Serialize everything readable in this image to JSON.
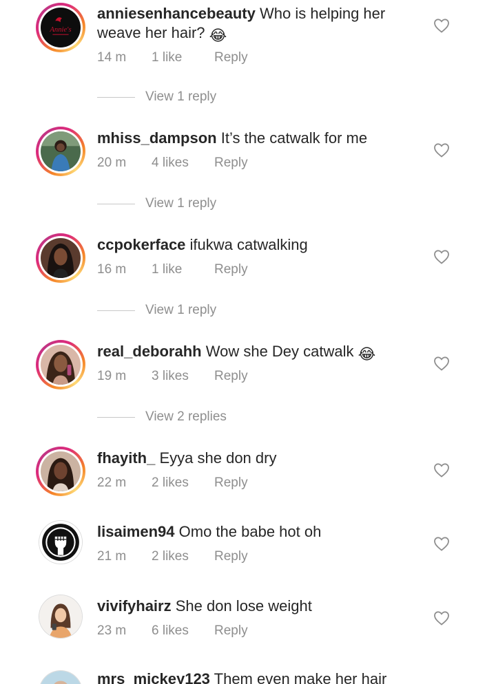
{
  "comments": [
    {
      "username": "anniesenhancebeauty",
      "text": "Who is helping her weave her hair?",
      "emoji": "😂",
      "time": "14 m",
      "likes": "1 like",
      "reply": "Reply",
      "view_replies": "View 1 reply",
      "avatar": "annies-logo"
    },
    {
      "username": "mhiss_dampson",
      "text": "It’s the catwalk for me",
      "time": "20 m",
      "likes": "4 likes",
      "reply": "Reply",
      "view_replies": "View 1 reply",
      "avatar": "woman-photo"
    },
    {
      "username": "ccpokerface",
      "text": "ifukwa catwalking",
      "time": "16 m",
      "likes": "1 like",
      "reply": "Reply",
      "view_replies": "View 1 reply",
      "avatar": "woman-photo"
    },
    {
      "username": "real_deborahh",
      "text": "Wow she Dey catwalk",
      "emoji": "😂",
      "time": "19 m",
      "likes": "3 likes",
      "reply": "Reply",
      "view_replies": "View 2 replies",
      "avatar": "woman-photo"
    },
    {
      "username": "fhayith_",
      "text": "Eyya she don dry",
      "time": "22 m",
      "likes": "2 likes",
      "reply": "Reply",
      "avatar": "woman-photo"
    },
    {
      "username": "lisaimen94",
      "text": "Omo the babe hot oh",
      "time": "21 m",
      "likes": "2 likes",
      "reply": "Reply",
      "avatar": "raised-fist-logo"
    },
    {
      "username": "vivifyhairz",
      "text": "She don lose weight",
      "time": "23 m",
      "likes": "6 likes",
      "reply": "Reply",
      "avatar": "illustrated-woman"
    },
    {
      "username": "mrs_mickey123",
      "text": "Them even make her hair",
      "avatar": "woman-photo"
    }
  ],
  "annies_logo_text": "Annie's",
  "colors": {
    "text": "#262626",
    "meta": "#8e8e8e",
    "ring_start": "#f58529",
    "ring_mid": "#dd2a7b",
    "ring_end": "#c13584"
  }
}
